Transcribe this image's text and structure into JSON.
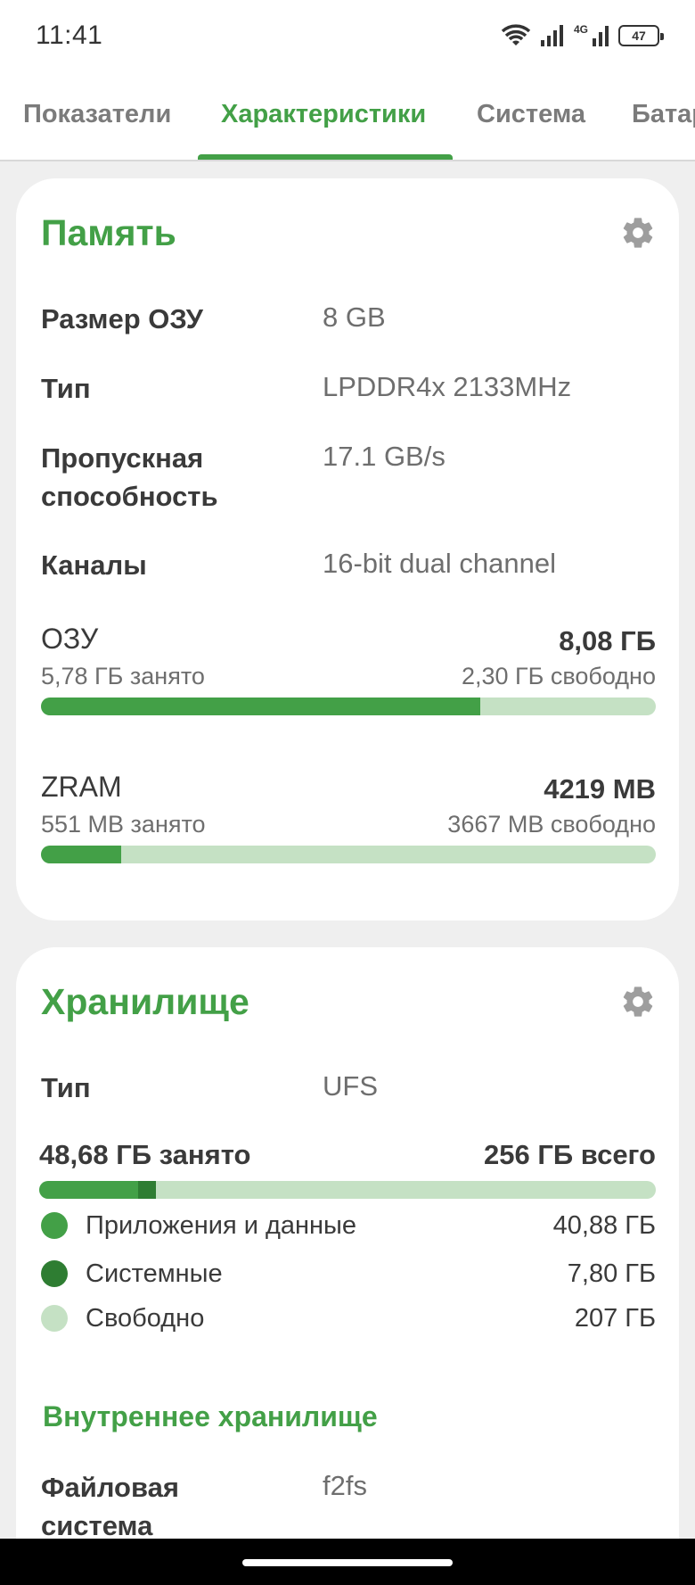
{
  "status_bar": {
    "time": "11:41",
    "network_type": "4G",
    "battery": "47",
    "icons": [
      "wifi-icon",
      "signal-icon",
      "battery-icon"
    ]
  },
  "tabs": [
    {
      "label": "Показатели",
      "active": false
    },
    {
      "label": "Характеристики",
      "active": true
    },
    {
      "label": "Система",
      "active": false
    },
    {
      "label": "Батар",
      "active": false
    }
  ],
  "memory": {
    "title": "Память",
    "rows": [
      {
        "label": "Размер ОЗУ",
        "value": "8 GB"
      },
      {
        "label": "Тип",
        "value": "LPDDR4x 2133MHz"
      },
      {
        "label": "Пропускная способность",
        "value": "17.1 GB/s"
      },
      {
        "label": "Каналы",
        "value": "16-bit dual channel"
      }
    ],
    "ram": {
      "title": "ОЗУ",
      "total": "8,08 ГБ",
      "used": "5,78 ГБ занято",
      "free": "2,30 ГБ свободно",
      "used_fraction": 0.715
    },
    "zram": {
      "title": "ZRAM",
      "total": "4219 MB",
      "used": "551 MB занято",
      "free": "3667 MB свободно",
      "used_fraction": 0.13
    }
  },
  "storage": {
    "title": "Хранилище",
    "type_label": "Тип",
    "type_value": "UFS",
    "used": "48,68 ГБ занято",
    "total": "256 ГБ всего",
    "apps_fraction": 0.16,
    "system_fraction": 0.03,
    "legend": [
      {
        "label": "Приложения и данные",
        "value": "40,88 ГБ",
        "color": "#43a047"
      },
      {
        "label": "Системные",
        "value": "7,80 ГБ",
        "color": "#2e7d32"
      },
      {
        "label": "Свободно",
        "value": "207 ГБ",
        "color": "#c5e1c4"
      }
    ],
    "internal": {
      "title": "Внутреннее хранилище",
      "fs_label": "Файловая система",
      "fs_value": "f2fs"
    }
  },
  "colors": {
    "accent": "#43a047",
    "accent_dark": "#2e7d32",
    "track": "#c5e1c4"
  }
}
